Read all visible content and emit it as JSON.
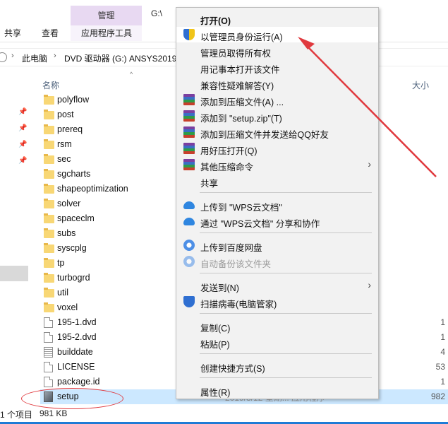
{
  "ribbon": {
    "context_tab_header": "管理",
    "tabs": [
      "共享",
      "查看",
      "应用程序工具"
    ],
    "window_title": "G:\\"
  },
  "address_bar": {
    "path": [
      "此电脑",
      "DVD 驱动器 (G:) ANSYS2019"
    ]
  },
  "file_list": {
    "columns": {
      "name": "名称",
      "size": "大小"
    },
    "items": [
      {
        "name": "polyflow",
        "type": "folder",
        "size": ""
      },
      {
        "name": "post",
        "type": "folder",
        "size": ""
      },
      {
        "name": "prereq",
        "type": "folder",
        "size": ""
      },
      {
        "name": "rsm",
        "type": "folder",
        "size": ""
      },
      {
        "name": "sec",
        "type": "folder",
        "size": ""
      },
      {
        "name": "sgcharts",
        "type": "folder",
        "size": ""
      },
      {
        "name": "shapeoptimization",
        "type": "folder",
        "size": ""
      },
      {
        "name": "solver",
        "type": "folder",
        "size": ""
      },
      {
        "name": "spaceclm",
        "type": "folder",
        "size": ""
      },
      {
        "name": "subs",
        "type": "folder",
        "size": ""
      },
      {
        "name": "syscplg",
        "type": "folder",
        "size": ""
      },
      {
        "name": "tp",
        "type": "folder",
        "size": ""
      },
      {
        "name": "turbogrd",
        "type": "folder",
        "size": ""
      },
      {
        "name": "util",
        "type": "folder",
        "size": ""
      },
      {
        "name": "voxel",
        "type": "folder",
        "size": ""
      },
      {
        "name": "195-1.dvd",
        "type": "file",
        "size": "1"
      },
      {
        "name": "195-2.dvd",
        "type": "file",
        "size": "1"
      },
      {
        "name": "builddate",
        "type": "text",
        "size": "4"
      },
      {
        "name": "LICENSE",
        "type": "file",
        "size": "53"
      },
      {
        "name": "package.id",
        "type": "file",
        "size": "1"
      },
      {
        "name": "setup",
        "type": "app",
        "size": "982",
        "selected": true
      }
    ],
    "selected_row_faded_text": "2019/3/12 星期... 应用程序"
  },
  "context_menu": {
    "items": [
      {
        "label": "打开(O)",
        "icon": "none",
        "bold": true
      },
      {
        "label": "以管理员身份运行(A)",
        "icon": "uac-shield-icon",
        "hot": true
      },
      {
        "label": "管理员取得所有权",
        "icon": "none"
      },
      {
        "label": "用记事本打开该文件",
        "icon": "none"
      },
      {
        "label": "兼容性疑难解答(Y)",
        "icon": "none"
      },
      {
        "label": "添加到压缩文件(A) ...",
        "icon": "winrar-icon"
      },
      {
        "label": "添加到 \"setup.zip\"(T)",
        "icon": "winrar-icon"
      },
      {
        "label": "添加到压缩文件并发送给QQ好友",
        "icon": "winrar-icon"
      },
      {
        "label": "用好压打开(Q)",
        "icon": "winrar-icon"
      },
      {
        "label": "其他压缩命令",
        "icon": "winrar-icon",
        "submenu": true
      },
      {
        "label": "共享",
        "icon": "share-icon"
      },
      {
        "separator": true
      },
      {
        "label": "上传到 \"WPS云文档\"",
        "icon": "cloud-upload-icon"
      },
      {
        "label": "通过 \"WPS云文档\" 分享和协作",
        "icon": "cloud-share-icon"
      },
      {
        "separator": true
      },
      {
        "label": "上传到百度网盘",
        "icon": "baidu-netdisk-icon"
      },
      {
        "label": "自动备份该文件夹",
        "icon": "baidu-netdisk-icon",
        "disabled": true
      },
      {
        "separator": true
      },
      {
        "label": "发送到(N)",
        "icon": "none",
        "submenu": true
      },
      {
        "label": "扫描病毒(电脑管家)",
        "icon": "tencent-shield-icon"
      },
      {
        "separator": true
      },
      {
        "label": "复制(C)",
        "icon": "none"
      },
      {
        "label": "粘贴(P)",
        "icon": "none"
      },
      {
        "separator": true
      },
      {
        "label": "创建快捷方式(S)",
        "icon": "none"
      },
      {
        "separator": true
      },
      {
        "label": "属性(R)",
        "icon": "none"
      }
    ]
  },
  "status_bar": {
    "item_count": "1 个项目",
    "selection_size": "981 KB"
  },
  "colors": {
    "annotation_red": "#e0393e",
    "selection_blue": "#cce8ff",
    "context_tab_purple": "#e8d9f2"
  }
}
